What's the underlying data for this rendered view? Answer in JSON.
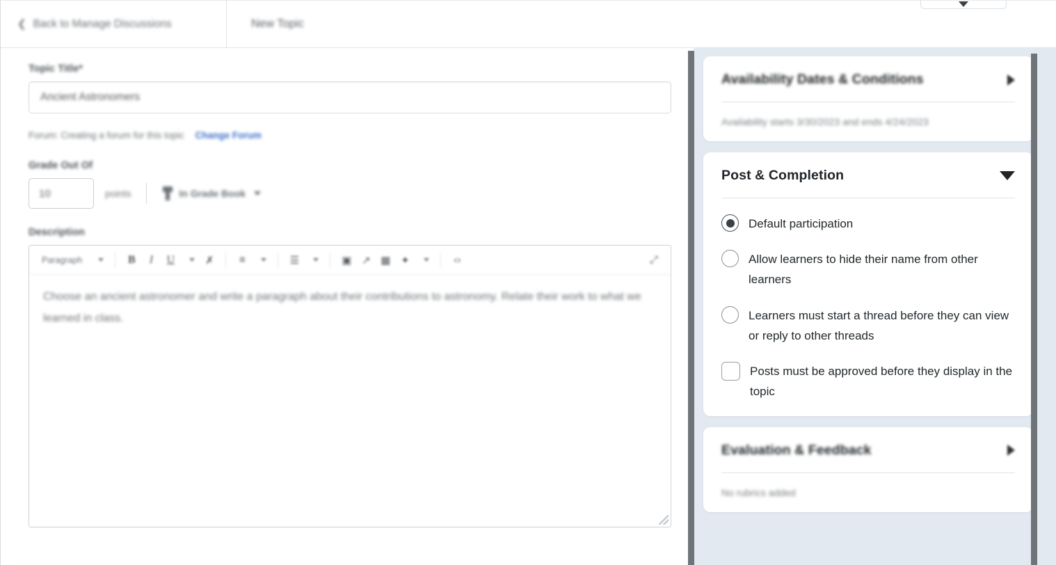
{
  "topbar": {
    "back_label": "Back to Manage Discussions",
    "back_icon": "chevron-left-icon",
    "title": "New Topic",
    "corner_caret_icon": "chevron-down-icon"
  },
  "form": {
    "topic_title_label": "Topic Title*",
    "topic_title_value": "Ancient Astronomers",
    "forum_text": "Forum: Creating a forum for this topic",
    "change_forum_link": "Change Forum",
    "grade_label": "Grade Out Of",
    "grade_value": "10",
    "points_label": "points",
    "gradebook_label": "In Grade Book",
    "gradebook_icon": "grade-book-icon",
    "gradebook_caret_icon": "chevron-down-icon",
    "description_label": "Description"
  },
  "editor": {
    "paragraph_style": "Paragraph",
    "tools": [
      {
        "name": "style-caret-icon",
        "glyph": "▾"
      },
      {
        "name": "bold-icon",
        "glyph": "B"
      },
      {
        "name": "italic-icon",
        "glyph": "I"
      },
      {
        "name": "underline-icon",
        "glyph": "U"
      },
      {
        "name": "underline-caret-icon",
        "glyph": "▾"
      },
      {
        "name": "clear-formatting-icon",
        "glyph": "✗"
      },
      {
        "name": "align-left-icon",
        "glyph": "≡"
      },
      {
        "name": "align-caret-icon",
        "glyph": "▾"
      },
      {
        "name": "bulleted-list-icon",
        "glyph": "☰"
      },
      {
        "name": "list-caret-icon",
        "glyph": "▾"
      },
      {
        "name": "insert-image-icon",
        "glyph": "▣"
      },
      {
        "name": "insert-link-icon",
        "glyph": "↗"
      },
      {
        "name": "insert-table-icon",
        "glyph": "▦"
      },
      {
        "name": "insert-more-icon",
        "glyph": "✦"
      },
      {
        "name": "insert-more-caret-icon",
        "glyph": "▾"
      },
      {
        "name": "html-source-icon",
        "glyph": "‹›"
      },
      {
        "name": "fullscreen-icon",
        "glyph": "⤢"
      }
    ],
    "body_text": "Choose an ancient astronomer and write a paragraph about their contributions to astronomy. Relate their work to what we learned in class.",
    "resize_handle_icon": "resize-grip-icon"
  },
  "panel": {
    "availability": {
      "title": "Availability Dates & Conditions",
      "chevron_icon": "chevron-right-icon",
      "subtitle": "Availability starts 3/30/2023 and ends 4/24/2023"
    },
    "post_completion": {
      "title": "Post & Completion",
      "chevron_icon": "chevron-down-icon",
      "options": [
        {
          "type": "radio",
          "checked": true,
          "label": "Default participation"
        },
        {
          "type": "radio",
          "checked": false,
          "label": "Allow learners to hide their name from other learners"
        },
        {
          "type": "radio",
          "checked": false,
          "label": "Learners must start a thread before they can view or reply to other threads"
        },
        {
          "type": "checkbox",
          "checked": false,
          "label": "Posts must be approved before they display in the topic"
        }
      ]
    },
    "evaluation": {
      "title": "Evaluation & Feedback",
      "chevron_icon": "chevron-right-icon",
      "subtitle": "No rubrics added"
    }
  },
  "scrollbars": {
    "left_name": "left-pane-scrollbar",
    "right_name": "right-panel-scrollbar"
  },
  "colors": {
    "link": "#3b6ec9",
    "panel_bg": "#e3e9f1",
    "scrollbar": "#6e7478",
    "text": "#22282c"
  }
}
